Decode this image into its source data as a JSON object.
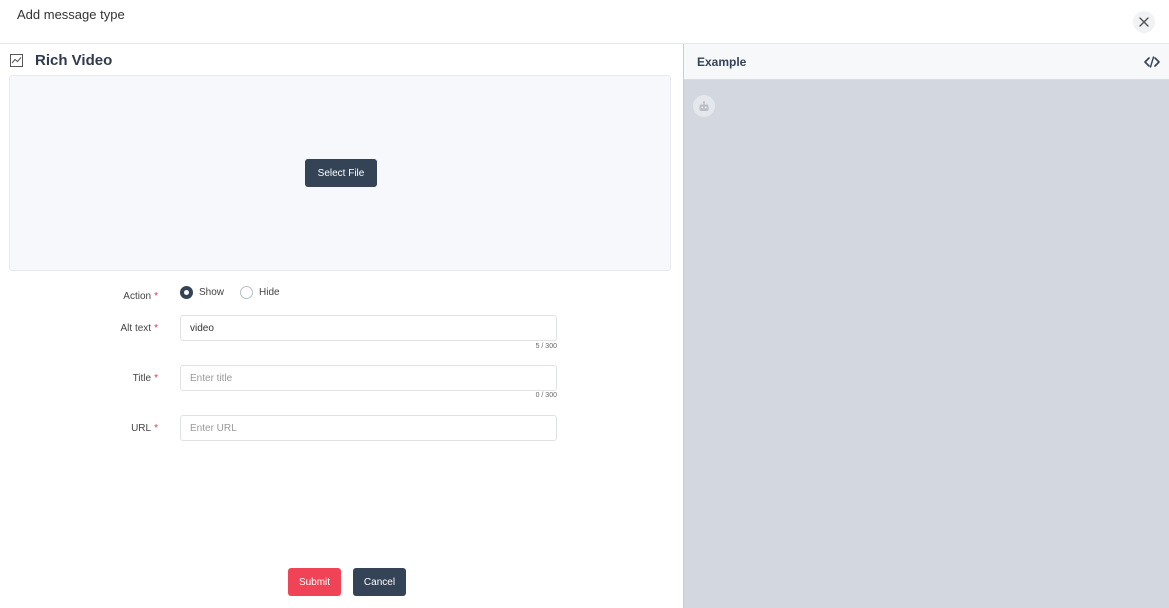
{
  "header": {
    "title": "Add message type"
  },
  "section": {
    "title": "Rich Video",
    "icon": "chart-line-icon"
  },
  "upload": {
    "button_label": "Select File"
  },
  "form": {
    "action": {
      "label": "Action",
      "required_mark": "*",
      "options": [
        "Show",
        "Hide"
      ],
      "selected": "Show"
    },
    "alt_text": {
      "label": "Alt text",
      "required_mark": "*",
      "value": "video",
      "counter": "5 / 300"
    },
    "title": {
      "label": "Title",
      "required_mark": "*",
      "placeholder": "Enter title",
      "counter": "0 / 300"
    },
    "url": {
      "label": "URL",
      "required_mark": "*",
      "placeholder": "Enter URL"
    }
  },
  "buttons": {
    "submit": "Submit",
    "cancel": "Cancel"
  },
  "preview": {
    "title": "Example",
    "code_icon": "code-icon",
    "avatar_icon": "robot-icon"
  },
  "colors": {
    "primary_dark": "#344356",
    "submit_red": "#f04456",
    "preview_bg": "#d3d8e0"
  }
}
